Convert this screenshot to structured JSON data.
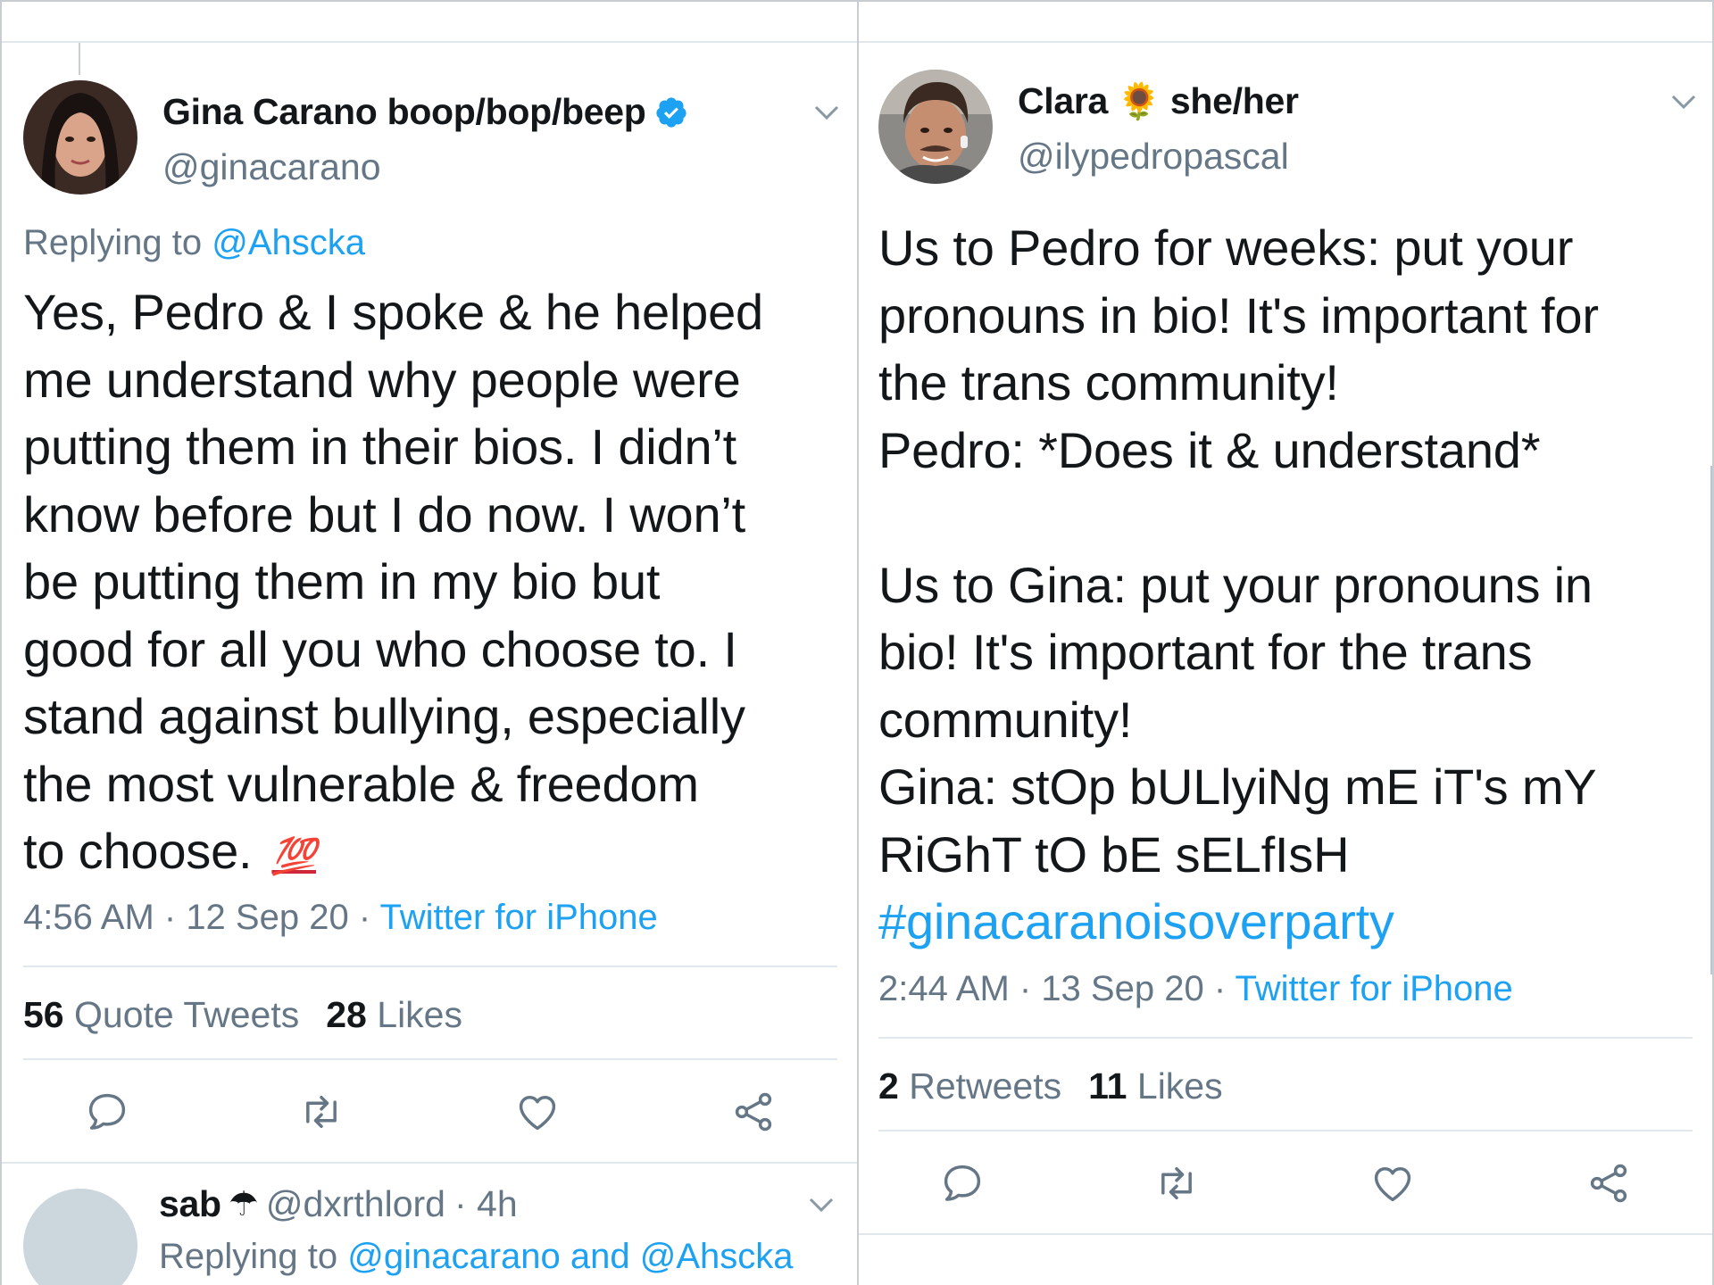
{
  "left": {
    "author": {
      "name": "Gina Carano boop/bop/beep",
      "handle": "@ginacarano",
      "verified": true,
      "avatar": "woman-portrait-avatar"
    },
    "reply": {
      "prefix": "Replying to ",
      "target": "@Ahscka"
    },
    "text_lines": [
      "Yes, Pedro & I spoke & he helped",
      "me understand why people were",
      "putting them in their bios. I didn’t",
      "know before but I do now. I won’t",
      "be putting them in my bio but",
      "good for all you who choose to. I",
      "stand against bullying, especially",
      "the most vulnerable & freedom",
      "to choose."
    ],
    "emoji": "💯",
    "meta": {
      "time": "4:56 AM",
      "date": "12 Sep 20",
      "source": "Twitter for iPhone",
      "sep": " · "
    },
    "stats": [
      {
        "count": "56",
        "label": "Quote Tweets"
      },
      {
        "count": "28",
        "label": "Likes"
      }
    ],
    "reply_preview": {
      "name": "sab",
      "emoji": "☂",
      "handle": "@dxrthlord",
      "time": "· 4h",
      "reply_prefix": "Replying to ",
      "reply_target_1": "@ginacarano",
      "reply_and": " and ",
      "reply_target_2": "@Ahscka"
    }
  },
  "right": {
    "author": {
      "name_part1": "Clara",
      "emoji": "🌻",
      "name_part2": "she/her",
      "handle": "@ilypedropascal",
      "avatar": "man-portrait-avatar"
    },
    "text_lines": [
      "Us to Pedro for weeks: put your",
      "pronouns in bio! It's important for",
      "the trans community!",
      "Pedro: *Does it & understand*",
      "",
      "Us to Gina: put your pronouns in",
      "bio! It's important for the trans",
      "community!",
      "Gina: stOp bULlyiNg mE iT's mY",
      "RiGhT tO bE sELfIsH"
    ],
    "hashtag": "#ginacaranoisoverparty",
    "meta": {
      "time": "2:44 AM",
      "date": "13 Sep 20",
      "source": "Twitter for iPhone",
      "sep": " · "
    },
    "stats": [
      {
        "count": "2",
        "label": "Retweets"
      },
      {
        "count": "11",
        "label": "Likes"
      }
    ]
  },
  "colors": {
    "link": "#1da1f2",
    "secondary": "#657786",
    "text": "#14171a",
    "divider": "#e1e8ed"
  },
  "icons": [
    "reply-icon",
    "retweet-icon",
    "like-icon",
    "share-icon",
    "chevron-down-icon",
    "verified-badge-icon"
  ]
}
